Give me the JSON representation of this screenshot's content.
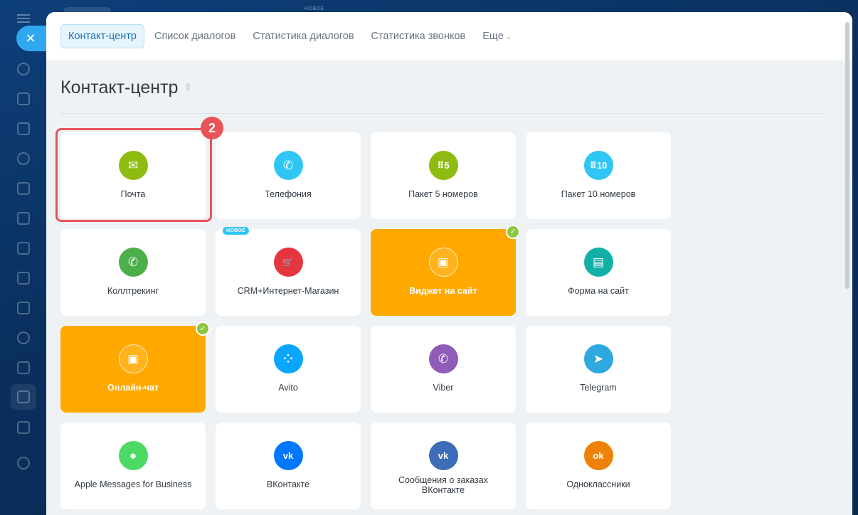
{
  "top": {
    "new_label": "НОВОЕ"
  },
  "tabs": [
    {
      "label": "Контакт-центр",
      "active": true
    },
    {
      "label": "Список диалогов",
      "active": false
    },
    {
      "label": "Статистика диалогов",
      "active": false
    },
    {
      "label": "Статистика звонков",
      "active": false
    },
    {
      "label": "Еще",
      "active": false
    }
  ],
  "page": {
    "title": "Контакт-центр"
  },
  "step_badge": "2",
  "cards": [
    {
      "label": "Почта",
      "icon": "mail-icon",
      "glyph": "✉",
      "color": "#8dbb10",
      "connected": false,
      "highlight": true
    },
    {
      "label": "Телефония",
      "icon": "phone-icon",
      "glyph": "✆",
      "color": "#2fc6f6",
      "connected": false
    },
    {
      "label": "Пакет 5 номеров",
      "icon": "package-5-icon",
      "glyph": "⠿5",
      "color": "#8dbb10",
      "connected": false
    },
    {
      "label": "Пакет 10 номеров",
      "icon": "package-10-icon",
      "glyph": "⠿10",
      "color": "#2fc6f6",
      "connected": false
    },
    {
      "label": "Коллтрекинг",
      "icon": "calltracking-icon",
      "glyph": "✆",
      "color": "#4cb04a",
      "connected": false
    },
    {
      "label": "CRM+Интернет-Магазин",
      "icon": "shop-icon",
      "glyph": "🛒",
      "color": "#e5353d",
      "connected": false,
      "new_badge": "НОВОЕ"
    },
    {
      "label": "Виджет на сайт",
      "icon": "widget-icon",
      "glyph": "▣",
      "color": "#ffa900",
      "connected": true,
      "orange": true
    },
    {
      "label": "Форма на сайт",
      "icon": "form-icon",
      "glyph": "▤",
      "color": "#12b1a8",
      "connected": false
    },
    {
      "label": "Онлайн-чат",
      "icon": "chat-icon",
      "glyph": "▣",
      "color": "#ffa900",
      "connected": true,
      "orange": true
    },
    {
      "label": "Avito",
      "icon": "avito-icon",
      "glyph": "⁘",
      "color": "#0aa5ff",
      "connected": false
    },
    {
      "label": "Viber",
      "icon": "viber-icon",
      "glyph": "✆",
      "color": "#8f5db7",
      "connected": false
    },
    {
      "label": "Telegram",
      "icon": "telegram-icon",
      "glyph": "➤",
      "color": "#2fa8e0",
      "connected": false
    },
    {
      "label": "Apple Messages for Business",
      "icon": "apple-messages-icon",
      "glyph": "●",
      "color": "#4cd964",
      "connected": false
    },
    {
      "label": "ВКонтакте",
      "icon": "vk-icon",
      "glyph": "vk",
      "color": "#0077ff",
      "connected": false
    },
    {
      "label": "Сообщения о заказах ВКонтакте",
      "icon": "vk-orders-icon",
      "glyph": "vk",
      "color": "#3d6cb9",
      "connected": false,
      "two_line": true
    },
    {
      "label": "Одноклассники",
      "icon": "ok-icon",
      "glyph": "ok",
      "color": "#ee8208",
      "connected": false
    }
  ]
}
